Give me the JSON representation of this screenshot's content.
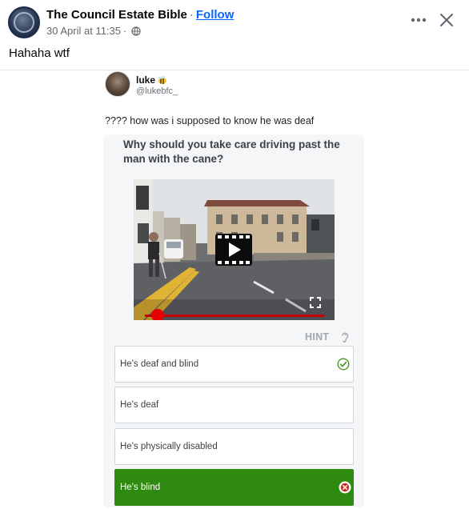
{
  "post": {
    "page_name": "The Council Estate Bible",
    "separator": "·",
    "follow_label": "Follow",
    "timestamp": "30 April at 11:35",
    "visibility_icon": "globe-icon",
    "caption": "Hahaha wtf"
  },
  "tweet": {
    "name": "luke",
    "name_emoji": "bee-icon",
    "handle": "@lukebfc_",
    "text": "???? how was i supposed to know he was deaf"
  },
  "quiz": {
    "question": "Why should you take care driving past the man with the cane?",
    "hint_label": "HINT",
    "video_progress_fraction": 0.07,
    "answers": [
      {
        "label": "He's deaf and blind",
        "state": "correct"
      },
      {
        "label": "He's deaf",
        "state": "neutral"
      },
      {
        "label": "He's physically disabled",
        "state": "neutral"
      },
      {
        "label": "He's blind",
        "state": "selected-wrong"
      }
    ]
  },
  "colors": {
    "follow_link": "#0866ff",
    "wrong_answer_bg": "#2e8b0f",
    "correct_check": "#4a9a24",
    "seek_bar": "#c40000"
  }
}
